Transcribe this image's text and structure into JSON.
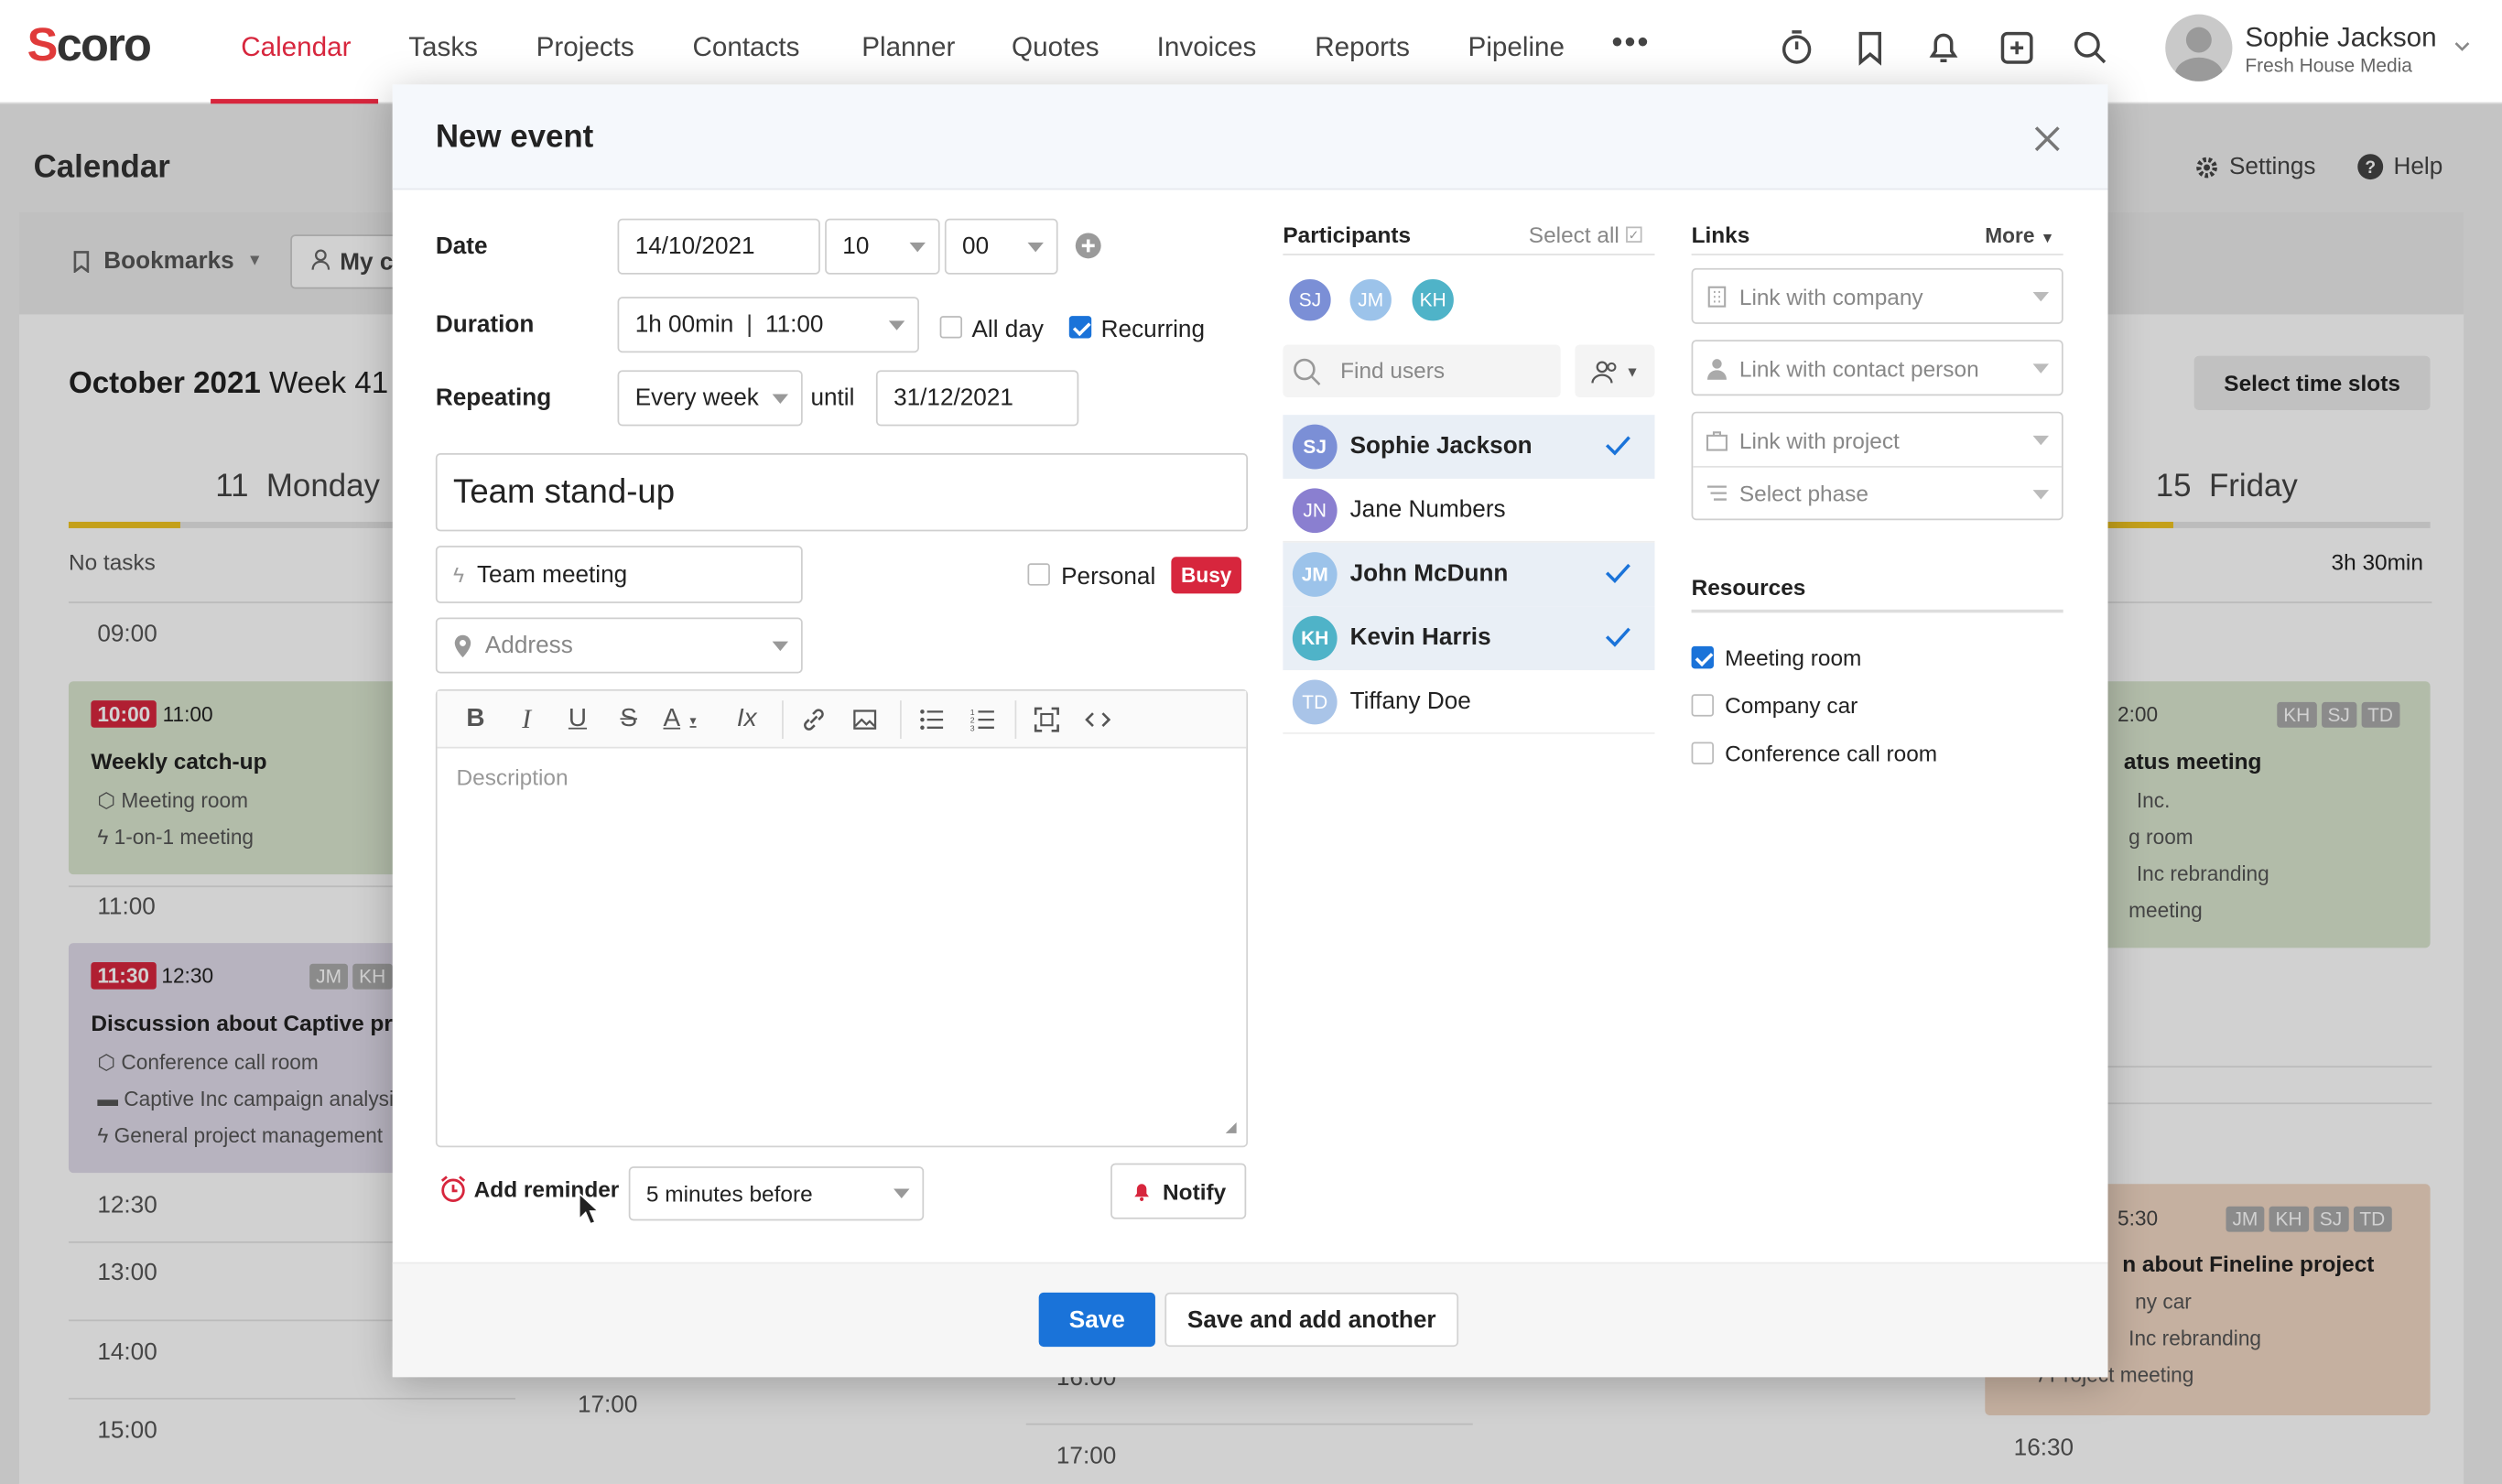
{
  "nav": {
    "brand": "Scoro",
    "items": [
      "Calendar",
      "Tasks",
      "Projects",
      "Contacts",
      "Planner",
      "Quotes",
      "Invoices",
      "Reports",
      "Pipeline"
    ],
    "more": "•••",
    "user_name": "Sophie Jackson",
    "user_company": "Fresh House Media",
    "accent_color": "#d7263d"
  },
  "calendar": {
    "title": "Calendar",
    "settings": "Settings",
    "help": "Help",
    "bookmarks": "Bookmarks",
    "my_calendar": "My c",
    "period_bold": "October 2021",
    "period_week": "Week 41",
    "select_time_slots": "Select time slots",
    "monday_num": "11",
    "monday_name": "Monday",
    "friday_num": "15",
    "friday_name": "Friday",
    "no_tasks": "No tasks",
    "friday_total": "3h 30min",
    "times": [
      "09:00",
      "11:00",
      "12:30",
      "13:00",
      "14:00",
      "15:00",
      "17:00",
      "16:00",
      "17:00",
      "16:30",
      "17:00"
    ],
    "events": [
      {
        "start": "10:00",
        "end": "11:00",
        "title": "Weekly catch-up",
        "line1": "Meeting room",
        "line2": "1-on-1 meeting"
      },
      {
        "start": "11:30",
        "end": "12:30",
        "title": "Discussion about Captive pr",
        "tags": [
          "JM",
          "KH"
        ],
        "line1": "Conference call room",
        "line2": "Captive Inc campaign analysi",
        "line3": "General project management"
      },
      {
        "start": "2:00",
        "title": "atus meeting",
        "tags": [
          "KH",
          "SJ",
          "TD"
        ],
        "line1": "Inc.",
        "line2": "g room",
        "line3": "Inc rebranding",
        "line4": "meeting"
      },
      {
        "start": "5:30",
        "title": "n about Fineline project",
        "tags": [
          "JM",
          "KH",
          "SJ",
          "TD"
        ],
        "line1": "ny car",
        "line2": "Inc rebranding",
        "line3": "Project meeting"
      }
    ]
  },
  "modal": {
    "title": "New event",
    "date_label": "Date",
    "date_value": "14/10/2021",
    "hour": "10",
    "minute": "00",
    "duration_label": "Duration",
    "duration_value": "1h 00min",
    "end_time": "11:00",
    "all_day": "All day",
    "recurring": "Recurring",
    "repeating_label": "Repeating",
    "repeating_value": "Every week",
    "until": "until",
    "until_value": "31/12/2021",
    "event_title": "Team stand-up",
    "activity_type": "Team meeting",
    "personal": "Personal",
    "busy": "Busy",
    "address_placeholder": "Address",
    "description_placeholder": "Description",
    "add_reminder": "Add reminder",
    "reminder_value": "5 minutes before",
    "notify": "Notify",
    "save": "Save",
    "save_add_another": "Save and add another",
    "participants_title": "Participants",
    "select_all": "Select all",
    "find_users_placeholder": "Find users",
    "selected_avatars": [
      "SJ",
      "JM",
      "KH"
    ],
    "participants": [
      {
        "initials": "SJ",
        "name": "Sophie Jackson",
        "checked": true,
        "color": "#7b8fd6"
      },
      {
        "initials": "JN",
        "name": "Jane Numbers",
        "checked": false,
        "color": "#8a7fd0"
      },
      {
        "initials": "JM",
        "name": "John McDunn",
        "checked": true,
        "color": "#9cc3ea"
      },
      {
        "initials": "KH",
        "name": "Kevin Harris",
        "checked": true,
        "color": "#4fb3c8"
      },
      {
        "initials": "TD",
        "name": "Tiffany Doe",
        "checked": false,
        "color": "#a9c4e8"
      }
    ],
    "links_title": "Links",
    "links_more": "More",
    "link_company": "Link with company",
    "link_contact": "Link with contact person",
    "link_project": "Link with project",
    "select_phase": "Select phase",
    "resources_title": "Resources",
    "resources": [
      {
        "name": "Meeting room",
        "checked": true
      },
      {
        "name": "Company car",
        "checked": false
      },
      {
        "name": "Conference call room",
        "checked": false
      }
    ]
  }
}
